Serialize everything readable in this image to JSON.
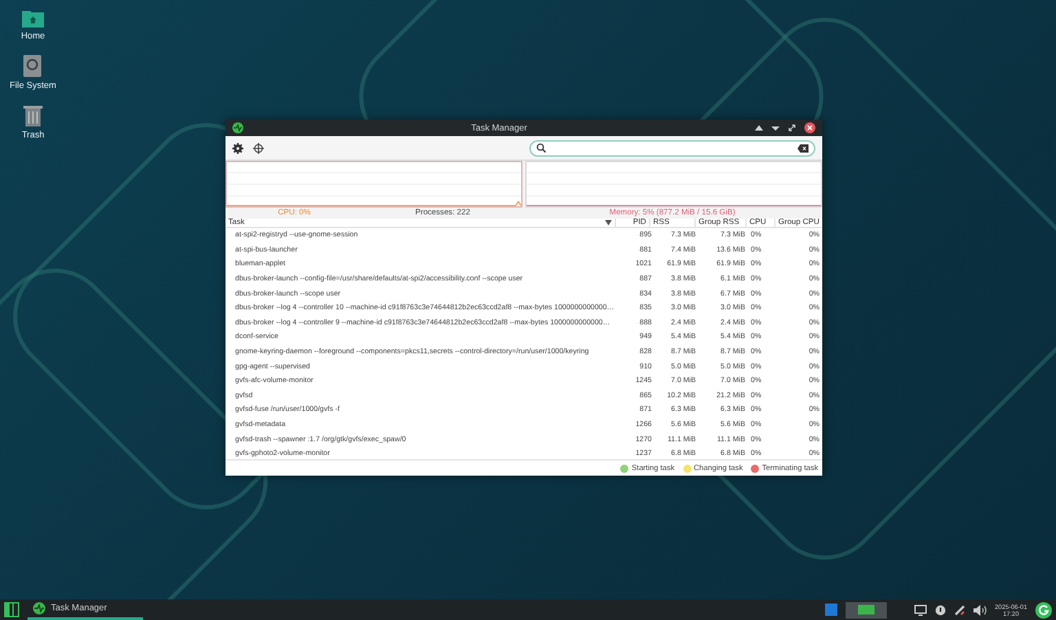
{
  "desktop_icons": [
    {
      "label": "Home",
      "kind": "folder"
    },
    {
      "label": "File System",
      "kind": "drive"
    },
    {
      "label": "Trash",
      "kind": "trash"
    }
  ],
  "window": {
    "title": "Task Manager"
  },
  "stats": {
    "cpu": "CPU: 0%",
    "processes": "Processes: 222",
    "memory": "Memory: 5% (877.2 MiB / 15.6 GiB)"
  },
  "table": {
    "columns": [
      {
        "label": "Task",
        "sorted": true
      },
      {
        "label": "PID",
        "sorted": false
      },
      {
        "label": "RSS",
        "sorted": false
      },
      {
        "label": "Group RSS",
        "sorted": false
      },
      {
        "label": "CPU",
        "sorted": false
      },
      {
        "label": "Group CPU",
        "sorted": false
      }
    ],
    "rows": [
      {
        "task": "at-spi2-registryd --use-gnome-session",
        "pid": "895",
        "rss": "7.3 MiB",
        "group_rss": "7.3 MiB",
        "cpu": "0%",
        "group_cpu": "0%"
      },
      {
        "task": "at-spi-bus-launcher",
        "pid": "881",
        "rss": "7.4 MiB",
        "group_rss": "13.6 MiB",
        "cpu": "0%",
        "group_cpu": "0%"
      },
      {
        "task": "blueman-applet",
        "pid": "1021",
        "rss": "61.9 MiB",
        "group_rss": "61.9 MiB",
        "cpu": "0%",
        "group_cpu": "0%"
      },
      {
        "task": "dbus-broker-launch --config-file=/usr/share/defaults/at-spi2/accessibility.conf --scope user",
        "pid": "887",
        "rss": "3.8 MiB",
        "group_rss": "6.1 MiB",
        "cpu": "0%",
        "group_cpu": "0%"
      },
      {
        "task": "dbus-broker-launch --scope user",
        "pid": "834",
        "rss": "3.8 MiB",
        "group_rss": "6.7 MiB",
        "cpu": "0%",
        "group_cpu": "0%"
      },
      {
        "task": "dbus-broker --log 4 --controller 10 --machine-id c91f8763c3e74644812b2ec63ccd2af8 --max-bytes 1000000000000…",
        "pid": "835",
        "rss": "3.0 MiB",
        "group_rss": "3.0 MiB",
        "cpu": "0%",
        "group_cpu": "0%"
      },
      {
        "task": "dbus-broker --log 4 --controller 9 --machine-id c91f8763c3e74644812b2ec63ccd2af8 --max-bytes 1000000000000…",
        "pid": "888",
        "rss": "2.4 MiB",
        "group_rss": "2.4 MiB",
        "cpu": "0%",
        "group_cpu": "0%"
      },
      {
        "task": "dconf-service",
        "pid": "949",
        "rss": "5.4 MiB",
        "group_rss": "5.4 MiB",
        "cpu": "0%",
        "group_cpu": "0%"
      },
      {
        "task": "gnome-keyring-daemon --foreground --components=pkcs11,secrets --control-directory=/run/user/1000/keyring",
        "pid": "828",
        "rss": "8.7 MiB",
        "group_rss": "8.7 MiB",
        "cpu": "0%",
        "group_cpu": "0%"
      },
      {
        "task": "gpg-agent --supervised",
        "pid": "910",
        "rss": "5.0 MiB",
        "group_rss": "5.0 MiB",
        "cpu": "0%",
        "group_cpu": "0%"
      },
      {
        "task": "gvfs-afc-volume-monitor",
        "pid": "1245",
        "rss": "7.0 MiB",
        "group_rss": "7.0 MiB",
        "cpu": "0%",
        "group_cpu": "0%"
      },
      {
        "task": "gvfsd",
        "pid": "865",
        "rss": "10.2 MiB",
        "group_rss": "21.2 MiB",
        "cpu": "0%",
        "group_cpu": "0%"
      },
      {
        "task": "gvfsd-fuse /run/user/1000/gvfs -f",
        "pid": "871",
        "rss": "6.3 MiB",
        "group_rss": "6.3 MiB",
        "cpu": "0%",
        "group_cpu": "0%"
      },
      {
        "task": "gvfsd-metadata",
        "pid": "1266",
        "rss": "5.6 MiB",
        "group_rss": "5.6 MiB",
        "cpu": "0%",
        "group_cpu": "0%"
      },
      {
        "task": "gvfsd-trash --spawner :1.7 /org/gtk/gvfs/exec_spaw/0",
        "pid": "1270",
        "rss": "11.1 MiB",
        "group_rss": "11.1 MiB",
        "cpu": "0%",
        "group_cpu": "0%"
      },
      {
        "task": "gvfs-gphoto2-volume-monitor",
        "pid": "1237",
        "rss": "6.8 MiB",
        "group_rss": "6.8 MiB",
        "cpu": "0%",
        "group_cpu": "0%"
      }
    ]
  },
  "legend": [
    {
      "label": "Starting task",
      "color": "#8fd27a"
    },
    {
      "label": "Changing task",
      "color": "#f5e36a"
    },
    {
      "label": "Terminating task",
      "color": "#e96a6a"
    }
  ],
  "taskbar": {
    "task": "Task Manager",
    "date": "2025-06-01",
    "time": "17:20"
  }
}
